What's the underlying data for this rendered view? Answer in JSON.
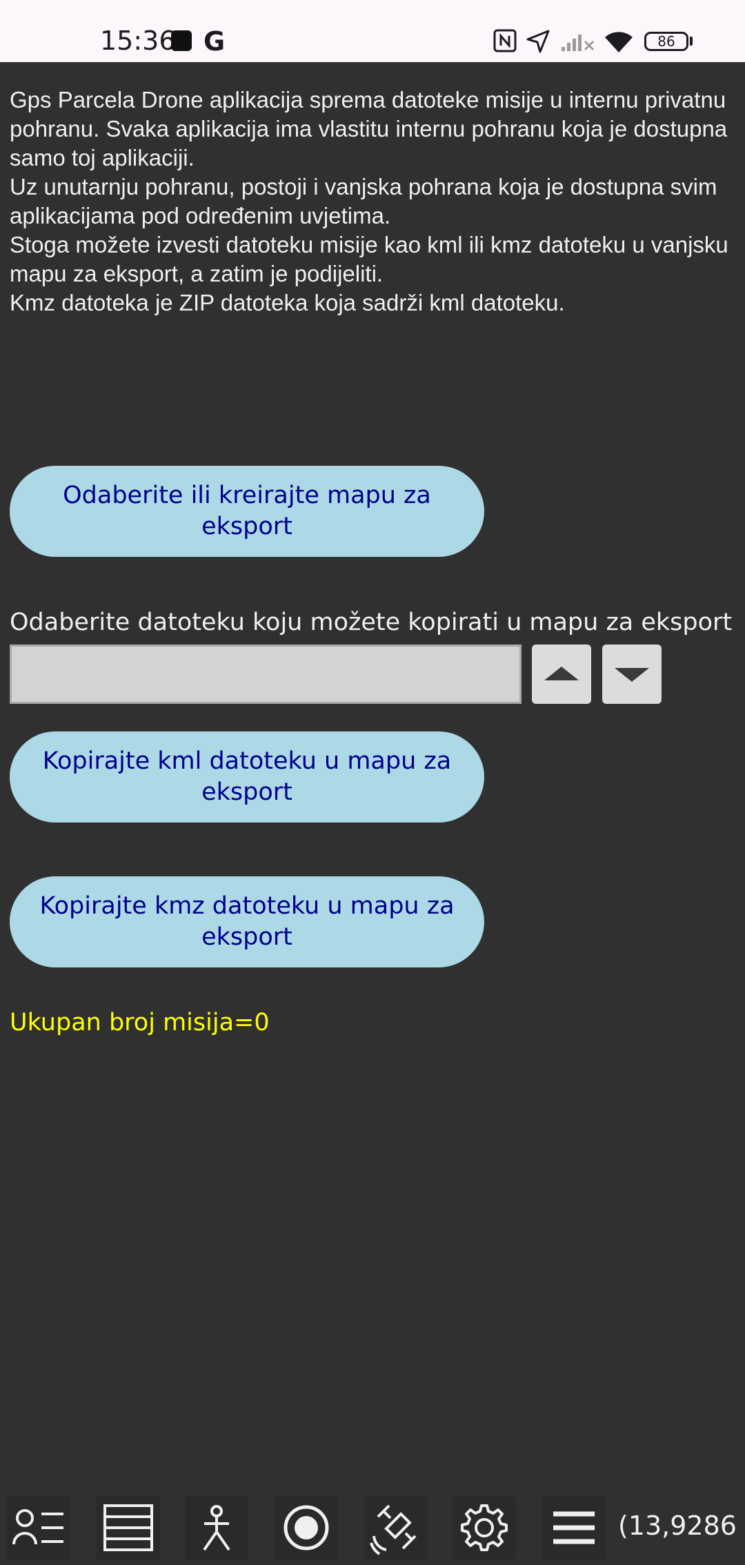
{
  "status_bar": {
    "time": "15:36",
    "g_icon": "G",
    "battery_level": "86",
    "icons": [
      "notification-square-icon",
      "google-icon",
      "nfc-icon",
      "location-arrow-icon",
      "signal-off-icon",
      "wifi-icon",
      "battery-icon"
    ]
  },
  "intro": {
    "lines": [
      "Gps Parcela Drone aplikacija sprema datoteke misije u internu privatnu pohranu. Svaka aplikacija ima vlastitu internu pohranu koja je dostupna samo toj aplikaciji.",
      "Uz unutarnju pohranu, postoji i vanjska pohrana koja je dostupna svim aplikacijama pod određenim uvjetima.",
      "Stoga možete izvesti datoteku misije kao kml ili kmz datoteku u vanjsku mapu za eksport, a zatim je podijeliti.",
      "Kmz datoteka je ZIP datoteka koja sadrži kml datoteku."
    ]
  },
  "buttons": {
    "create_folder": "Odaberite ili kreirajte mapu za eksport",
    "copy_kml": "Kopirajte kml datoteku u mapu za eksport",
    "copy_kmz": "Kopirajte kmz datoteku u mapu za eksport"
  },
  "file_select": {
    "label": "Odaberite datoteku koju možete kopirati u mapu za eksport",
    "value": ""
  },
  "mission_count": "Ukupan broj misija=0",
  "navbar": {
    "items": [
      "user-list-icon",
      "list-icon",
      "survey-icon",
      "record-icon",
      "satellite-icon",
      "gear-icon",
      "menu-icon"
    ],
    "coords": "(13,9286"
  },
  "colors": {
    "background": "#303030",
    "button_bg": "#add8e6",
    "button_text": "#00008b",
    "mission_count": "#ffff00"
  }
}
